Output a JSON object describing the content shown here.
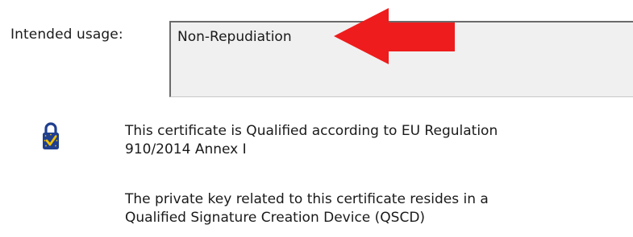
{
  "usage": {
    "label": "Intended usage:",
    "value": "Non-Repudiation"
  },
  "qualified": {
    "line1": "This certificate is Qualified according to EU Regulation",
    "line2": "910/2014 Annex I"
  },
  "qscd": {
    "line1": "The private key related to this certificate resides in a",
    "line2": "Qualified Signature Creation Device (QSCD)"
  },
  "colors": {
    "arrow": "#ee1c1c",
    "lock_body": "#1f3f8f",
    "check": "#f2c200"
  },
  "icons": [
    "eu-trust-lock-icon",
    "red-arrow-icon"
  ]
}
